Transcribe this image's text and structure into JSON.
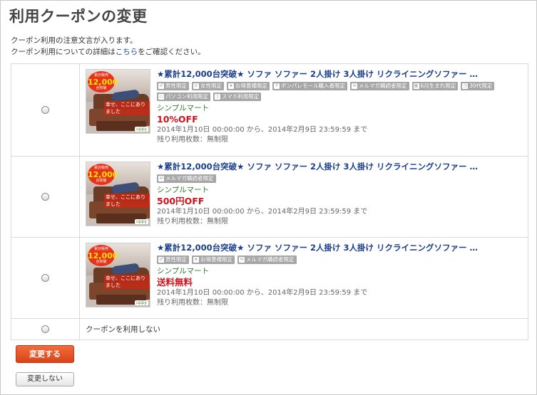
{
  "page": {
    "title": "利用クーポンの変更"
  },
  "notice": {
    "line1": "クーポン利用の注意文言が入ります。",
    "line2_prefix": "クーポン利用についての詳細は",
    "line2_link": "こちら",
    "line2_suffix": "をご確認ください。"
  },
  "coupons": [
    {
      "item_name": "★累計12,000台突破★ ソファ ソファー 2人掛け 3人掛け リクライニングソファー …",
      "tags": [
        {
          "icon": "male-icon",
          "label": "男性限定"
        },
        {
          "icon": "female-icon",
          "label": "女性限定"
        },
        {
          "icon": "vip-icon",
          "label": "お得意様限定"
        },
        {
          "icon": "pointmall-icon",
          "label": "ポンパレモール購入者限定"
        },
        {
          "icon": "mail-icon",
          "label": "メルマガ購読者限定"
        },
        {
          "icon": "calendar-icon",
          "label": "6月生まれ限定"
        },
        {
          "icon": "clock-icon",
          "label": "30代限定"
        },
        {
          "icon": "pc-icon",
          "label": "パソコン利用限定"
        },
        {
          "icon": "smartphone-icon",
          "label": "スマホ利用限定"
        }
      ],
      "shop": "シンプルマート",
      "discount": "10%OFF",
      "period": "2014年1月10日 00:00:00 から、2014年2月9日 23:59:59 まで",
      "remain": "残り利用枚数：無制限"
    },
    {
      "item_name": "★累計12,000台突破★ ソファ ソファー 2人掛け 3人掛け リクライニングソファー …",
      "tags": [
        {
          "icon": "mail-icon",
          "label": "メルマガ購読者限定"
        }
      ],
      "shop": "シンプルマート",
      "discount": "500円OFF",
      "period": "2014年1月10日 00:00:00 から、2014年2月9日 23:59:59 まで",
      "remain": "残り利用枚数：無制限"
    },
    {
      "item_name": "★累計12,000台突破★ ソファ ソファー 2人掛け 3人掛け リクライニングソファー …",
      "tags": [
        {
          "icon": "male-icon",
          "label": "男性限定"
        },
        {
          "icon": "vip-icon",
          "label": "お得意様限定"
        },
        {
          "icon": "mail-icon",
          "label": "メルマガ購読者限定"
        }
      ],
      "shop": "シンプルマート",
      "discount": "送料無料",
      "period": "2014年1月10日 00:00:00 から、2014年2月9日 23:59:59 まで",
      "remain": "残り利用枚数：無制限"
    }
  ],
  "thumb": {
    "badge_top": "累計販売",
    "badge_num": "12,000",
    "badge_bottom": "台突破",
    "catch": "幸せ、ここにありました",
    "brand": "uppy"
  },
  "no_coupon_label": "クーポンを利用しない",
  "buttons": {
    "change": "変更する",
    "no_change": "変更しない"
  }
}
